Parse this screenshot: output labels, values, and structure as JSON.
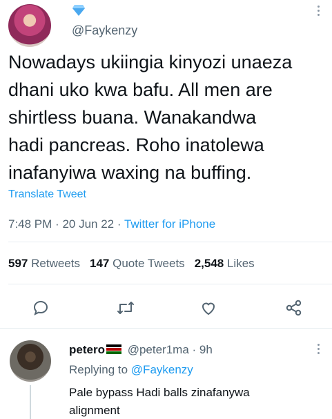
{
  "author": {
    "handle": "@Faykenzy",
    "verified_icon": "diamond-icon"
  },
  "tweet": {
    "lines": [
      "Nowadays ukiingia kinyozi unaeza",
      "dhani uko kwa bafu. All men are",
      "shirtless buana. Wanakandwa",
      "hadi pancreas. Roho inatolewa",
      "inafanyiwa waxing na buffing."
    ],
    "translate_label": "Translate Tweet",
    "time": "7:48 PM",
    "date": "20 Jun 22",
    "source": "Twitter for iPhone"
  },
  "stats": {
    "retweets_count": "597",
    "retweets_label": "Retweets",
    "quotes_count": "147",
    "quotes_label": "Quote Tweets",
    "likes_count": "2,548",
    "likes_label": "Likes"
  },
  "actions": [
    "reply-icon",
    "retweet-icon",
    "like-icon",
    "share-icon"
  ],
  "reply": {
    "name": "petero",
    "flag": "kenya-flag-icon",
    "handle": "@peter1ma",
    "time": "9h",
    "replying_prefix": "Replying to",
    "replying_to": "@Faykenzy",
    "text_lines": [
      "Pale bypass Hadi balls zinafanywa",
      "alignment"
    ]
  },
  "colors": {
    "link": "#1d9bf0",
    "muted": "#536471",
    "text": "#0f1419"
  }
}
